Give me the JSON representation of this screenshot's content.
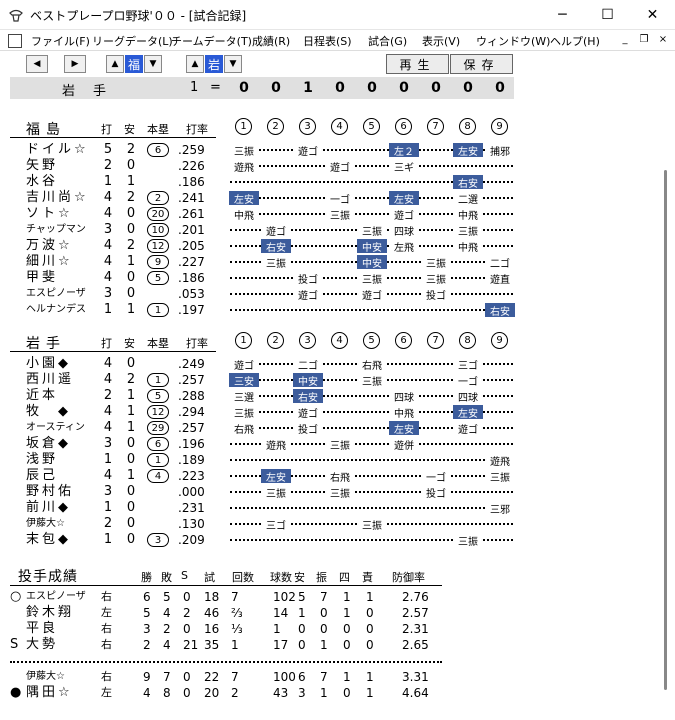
{
  "window": {
    "title": "ベストプレープロ野球'００ - [試合記録]",
    "controls": [
      "─",
      "☐",
      "✕"
    ]
  },
  "menu": [
    "ファイル(F)",
    "リーグデータ(L)",
    "チームデータ(T)",
    "成績(R)",
    "日程表(S)",
    "試合(G)",
    "表示(V)",
    "ウィンドウ(W)",
    "ヘルプ(H)"
  ],
  "mdi_controls": [
    "_",
    "❐",
    "×"
  ],
  "toolbar": {
    "team_away_tag": "福",
    "team_home_tag": "岩",
    "replay_label": "再生",
    "save_label": "保存"
  },
  "scoreboard": {
    "team": "岩手",
    "runs": "1",
    "equals": "=",
    "innings": [
      "0",
      "0",
      "1",
      "0",
      "0",
      "0",
      "0",
      "0",
      "0"
    ]
  },
  "batting_headers": {
    "ab": "打",
    "h": "安",
    "hr": "本塁",
    "avg": "打率",
    "innings": [
      "1",
      "2",
      "3",
      "4",
      "5",
      "6",
      "7",
      "8",
      "9"
    ]
  },
  "team1": {
    "name": "福島",
    "batters": [
      {
        "name": "ドイル☆",
        "ab": "5",
        "h": "2",
        "hr": "6",
        "avg": ".259",
        "sm": false,
        "results": [
          {
            "inn": 1,
            "text": "三振",
            "hit": false
          },
          {
            "inn": 3,
            "text": "遊ゴ",
            "hit": false
          },
          {
            "inn": 6,
            "text": "左２",
            "hit": true
          },
          {
            "inn": 8,
            "text": "左安",
            "hit": true
          },
          {
            "inn": 9,
            "text": "捕邪",
            "hit": false
          }
        ]
      },
      {
        "name": "矢野",
        "ab": "2",
        "h": "0",
        "hr": "",
        "avg": ".226",
        "sm": false,
        "results": [
          {
            "inn": 1,
            "text": "遊飛",
            "hit": false
          },
          {
            "inn": 4,
            "text": "遊ゴ",
            "hit": false
          },
          {
            "inn": 6,
            "text": "三ギ",
            "hit": false
          }
        ]
      },
      {
        "name": "水谷",
        "ab": "1",
        "h": "1",
        "hr": "",
        "avg": ".186",
        "sm": false,
        "results": [
          {
            "inn": 8,
            "text": "右安",
            "hit": true
          }
        ]
      },
      {
        "name": "吉川尚☆",
        "ab": "4",
        "h": "2",
        "hr": "2",
        "avg": ".241",
        "sm": false,
        "results": [
          {
            "inn": 1,
            "text": "左安",
            "hit": true
          },
          {
            "inn": 4,
            "text": "一ゴ",
            "hit": false
          },
          {
            "inn": 6,
            "text": "左安",
            "hit": true
          },
          {
            "inn": 8,
            "text": "二選",
            "hit": false
          }
        ]
      },
      {
        "name": "ソト☆",
        "ab": "4",
        "h": "0",
        "hr": "20",
        "avg": ".261",
        "sm": false,
        "results": [
          {
            "inn": 1,
            "text": "中飛",
            "hit": false
          },
          {
            "inn": 4,
            "text": "三振",
            "hit": false
          },
          {
            "inn": 6,
            "text": "遊ゴ",
            "hit": false
          },
          {
            "inn": 8,
            "text": "中飛",
            "hit": false
          }
        ]
      },
      {
        "name": "チャップマン",
        "ab": "3",
        "h": "0",
        "hr": "10",
        "avg": ".201",
        "sm": true,
        "results": [
          {
            "inn": 2,
            "text": "遊ゴ",
            "hit": false
          },
          {
            "inn": 5,
            "text": "三振",
            "hit": false
          },
          {
            "inn": 6,
            "text": "四球",
            "hit": false
          },
          {
            "inn": 8,
            "text": "三振",
            "hit": false
          }
        ]
      },
      {
        "name": "万波☆",
        "ab": "4",
        "h": "2",
        "hr": "12",
        "avg": ".205",
        "sm": false,
        "results": [
          {
            "inn": 2,
            "text": "右安",
            "hit": true
          },
          {
            "inn": 5,
            "text": "中安",
            "hit": true
          },
          {
            "inn": 6,
            "text": "左飛",
            "hit": false
          },
          {
            "inn": 8,
            "text": "中飛",
            "hit": false
          }
        ]
      },
      {
        "name": "細川☆",
        "ab": "4",
        "h": "1",
        "hr": "9",
        "avg": ".227",
        "sm": false,
        "results": [
          {
            "inn": 2,
            "text": "三振",
            "hit": false
          },
          {
            "inn": 5,
            "text": "中安",
            "hit": true
          },
          {
            "inn": 7,
            "text": "三振",
            "hit": false
          },
          {
            "inn": 9,
            "text": "二ゴ",
            "hit": false
          }
        ]
      },
      {
        "name": "甲斐",
        "ab": "4",
        "h": "0",
        "hr": "5",
        "avg": ".186",
        "sm": false,
        "results": [
          {
            "inn": 3,
            "text": "投ゴ",
            "hit": false
          },
          {
            "inn": 5,
            "text": "三振",
            "hit": false
          },
          {
            "inn": 7,
            "text": "三振",
            "hit": false
          },
          {
            "inn": 9,
            "text": "遊直",
            "hit": false
          }
        ]
      },
      {
        "name": "エスピノーザ",
        "ab": "3",
        "h": "0",
        "hr": "",
        "avg": ".053",
        "sm": true,
        "results": [
          {
            "inn": 3,
            "text": "遊ゴ",
            "hit": false
          },
          {
            "inn": 5,
            "text": "遊ゴ",
            "hit": false
          },
          {
            "inn": 7,
            "text": "投ゴ",
            "hit": false
          }
        ]
      },
      {
        "name": "ヘルナンデス",
        "ab": "1",
        "h": "1",
        "hr": "1",
        "avg": ".197",
        "sm": true,
        "results": [
          {
            "inn": 9,
            "text": "右安",
            "hit": true
          }
        ]
      }
    ]
  },
  "team2": {
    "name": "岩手",
    "batters": [
      {
        "name": "小園◆",
        "ab": "4",
        "h": "0",
        "hr": "",
        "avg": ".249",
        "sm": false,
        "results": [
          {
            "inn": 1,
            "text": "遊ゴ",
            "hit": false
          },
          {
            "inn": 3,
            "text": "二ゴ",
            "hit": false
          },
          {
            "inn": 5,
            "text": "右飛",
            "hit": false
          },
          {
            "inn": 8,
            "text": "三ゴ",
            "hit": false
          }
        ]
      },
      {
        "name": "西川遥",
        "ab": "4",
        "h": "2",
        "hr": "1",
        "avg": ".257",
        "sm": false,
        "results": [
          {
            "inn": 1,
            "text": "三安",
            "hit": true
          },
          {
            "inn": 3,
            "text": "中安",
            "hit": true
          },
          {
            "inn": 5,
            "text": "三振",
            "hit": false
          },
          {
            "inn": 8,
            "text": "一ゴ",
            "hit": false
          }
        ]
      },
      {
        "name": "近本",
        "ab": "2",
        "h": "1",
        "hr": "5",
        "avg": ".288",
        "sm": false,
        "results": [
          {
            "inn": 1,
            "text": "三選",
            "hit": false
          },
          {
            "inn": 3,
            "text": "右安",
            "hit": true
          },
          {
            "inn": 6,
            "text": "四球",
            "hit": false
          },
          {
            "inn": 8,
            "text": "四球",
            "hit": false
          }
        ]
      },
      {
        "name": "牧　◆",
        "ab": "4",
        "h": "1",
        "hr": "12",
        "avg": ".294",
        "sm": false,
        "results": [
          {
            "inn": 1,
            "text": "三振",
            "hit": false
          },
          {
            "inn": 3,
            "text": "遊ゴ",
            "hit": false
          },
          {
            "inn": 6,
            "text": "中飛",
            "hit": false
          },
          {
            "inn": 8,
            "text": "左安",
            "hit": true
          }
        ]
      },
      {
        "name": "オースティン",
        "ab": "4",
        "h": "1",
        "hr": "29",
        "avg": ".257",
        "sm": true,
        "results": [
          {
            "inn": 1,
            "text": "右飛",
            "hit": false
          },
          {
            "inn": 3,
            "text": "投ゴ",
            "hit": false
          },
          {
            "inn": 6,
            "text": "左安",
            "hit": true
          },
          {
            "inn": 8,
            "text": "遊ゴ",
            "hit": false
          }
        ]
      },
      {
        "name": "坂倉◆",
        "ab": "3",
        "h": "0",
        "hr": "6",
        "avg": ".196",
        "sm": false,
        "results": [
          {
            "inn": 2,
            "text": "遊飛",
            "hit": false
          },
          {
            "inn": 4,
            "text": "三振",
            "hit": false
          },
          {
            "inn": 6,
            "text": "遊併",
            "hit": false
          }
        ]
      },
      {
        "name": "浅野",
        "ab": "1",
        "h": "0",
        "hr": "1",
        "avg": ".189",
        "sm": false,
        "results": [
          {
            "inn": 9,
            "text": "遊飛",
            "hit": false
          }
        ]
      },
      {
        "name": "辰己",
        "ab": "4",
        "h": "1",
        "hr": "4",
        "avg": ".223",
        "sm": false,
        "results": [
          {
            "inn": 2,
            "text": "左安",
            "hit": true
          },
          {
            "inn": 4,
            "text": "右飛",
            "hit": false
          },
          {
            "inn": 7,
            "text": "一ゴ",
            "hit": false
          },
          {
            "inn": 9,
            "text": "三振",
            "hit": false
          }
        ]
      },
      {
        "name": "野村佑",
        "ab": "3",
        "h": "0",
        "hr": "",
        "avg": ".000",
        "sm": false,
        "results": [
          {
            "inn": 2,
            "text": "三振",
            "hit": false
          },
          {
            "inn": 4,
            "text": "三振",
            "hit": false
          },
          {
            "inn": 7,
            "text": "投ゴ",
            "hit": false
          }
        ]
      },
      {
        "name": "前川◆",
        "ab": "1",
        "h": "0",
        "hr": "",
        "avg": ".231",
        "sm": false,
        "results": [
          {
            "inn": 9,
            "text": "三邪",
            "hit": false
          }
        ]
      },
      {
        "name": "伊藤大☆",
        "ab": "2",
        "h": "0",
        "hr": "",
        "avg": ".130",
        "sm": true,
        "results": [
          {
            "inn": 2,
            "text": "三ゴ",
            "hit": false
          },
          {
            "inn": 5,
            "text": "三振",
            "hit": false
          }
        ]
      },
      {
        "name": "末包◆",
        "ab": "1",
        "h": "0",
        "hr": "3",
        "avg": ".209",
        "sm": false,
        "results": [
          {
            "inn": 8,
            "text": "三振",
            "hit": false
          }
        ]
      }
    ]
  },
  "pitching": {
    "title": "投手成績",
    "headers": [
      "勝",
      "敗",
      "S",
      "試",
      "回数",
      "球数",
      "安",
      "振",
      "四",
      "責",
      "防御率"
    ],
    "team1": [
      {
        "mark": "○",
        "name": "エスピノーザ",
        "sm": true,
        "hand": "右",
        "w": "6",
        "l": "5",
        "s": "0",
        "g": "18",
        "ip": "7",
        "pitches": "102",
        "h": "5",
        "so": "7",
        "bb": "1",
        "er": "1",
        "era": "2.76"
      },
      {
        "mark": "",
        "name": "鈴木翔",
        "sm": false,
        "hand": "左",
        "w": "5",
        "l": "4",
        "s": "2",
        "g": "46",
        "ip": "⅔",
        "pitches": "14",
        "h": "1",
        "so": "0",
        "bb": "1",
        "er": "0",
        "era": "2.57"
      },
      {
        "mark": "",
        "name": "平良",
        "sm": false,
        "hand": "右",
        "w": "3",
        "l": "2",
        "s": "0",
        "g": "16",
        "ip": "⅓",
        "pitches": "1",
        "h": "0",
        "so": "0",
        "bb": "0",
        "er": "0",
        "era": "2.31"
      },
      {
        "mark": "S",
        "name": "大勢",
        "sm": false,
        "hand": "右",
        "w": "2",
        "l": "4",
        "s": "21",
        "g": "35",
        "ip": "1",
        "pitches": "17",
        "h": "0",
        "so": "1",
        "bb": "0",
        "er": "0",
        "era": "2.65"
      }
    ],
    "team2": [
      {
        "mark": "",
        "name": "伊藤大☆",
        "sm": true,
        "hand": "右",
        "w": "9",
        "l": "7",
        "s": "0",
        "g": "22",
        "ip": "7",
        "pitches": "100",
        "h": "6",
        "so": "7",
        "bb": "1",
        "er": "1",
        "era": "3.31"
      },
      {
        "mark": "●",
        "name": "隅田☆",
        "sm": false,
        "hand": "左",
        "w": "4",
        "l": "8",
        "s": "0",
        "g": "20",
        "ip": "2",
        "pitches": "43",
        "h": "3",
        "so": "1",
        "bb": "0",
        "er": "1",
        "era": "4.64"
      }
    ]
  }
}
